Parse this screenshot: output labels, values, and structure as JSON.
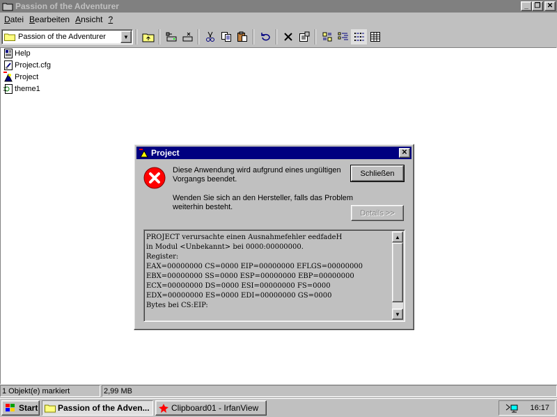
{
  "window": {
    "title": "Passion of the Adventurer",
    "min_label": "_",
    "max_label": "❐",
    "close_label": "✕"
  },
  "menu": [
    {
      "label": "Datei",
      "underline": "D"
    },
    {
      "label": "Bearbeiten",
      "underline": "B"
    },
    {
      "label": "Ansicht",
      "underline": "A"
    },
    {
      "label": "?",
      "underline": "?"
    }
  ],
  "toolbar": {
    "folder_combo_value": "Passion of the Adventurer",
    "buttons": [
      "up-folder-icon",
      "map-drive-icon",
      "disconnect-drive-icon",
      "cut-icon",
      "copy-icon",
      "paste-icon",
      "undo-icon",
      "delete-icon",
      "properties-icon",
      "large-icons-icon",
      "small-icons-icon",
      "list-icon",
      "details-icon"
    ]
  },
  "files": [
    {
      "name": "Help",
      "icon": "help-file-icon"
    },
    {
      "name": "Project.cfg",
      "icon": "cfg-file-icon"
    },
    {
      "name": "Project",
      "icon": "exe-file-icon"
    },
    {
      "name": "theme1",
      "icon": "theme-file-icon"
    }
  ],
  "statusbar": {
    "selection": "1 Objekt(e) markiert",
    "size": "2,99 MB"
  },
  "dialog": {
    "title": "Project",
    "close_label": "✕",
    "message1": "Diese Anwendung wird aufgrund eines ungültigen Vorgangs beendet.",
    "message2": "Wenden Sie sich an den Hersteller, falls das Problem weiterhin besteht.",
    "close_button": "Schließen",
    "details_button": "Details >>",
    "details_lines": [
      "PROJECT verursachte einen Ausnahmefehler eedfadeH",
      "in Modul <Unbekannt> bei 0000:00000000.",
      "Register:",
      "EAX=00000000 CS=0000 EIP=00000000 EFLGS=00000000",
      "EBX=00000000 SS=0000 ESP=00000000 EBP=00000000",
      "ECX=00000000 DS=0000 ESI=00000000 FS=0000",
      "EDX=00000000 ES=0000 EDI=00000000 GS=0000",
      "Bytes bei CS:EIP:"
    ]
  },
  "taskbar": {
    "start_label": "Start",
    "tasks": [
      {
        "label": "Passion of the Adven...",
        "active": true
      },
      {
        "label": "Clipboard01 - IrfanView",
        "active": false
      }
    ],
    "clock": "16:17"
  }
}
